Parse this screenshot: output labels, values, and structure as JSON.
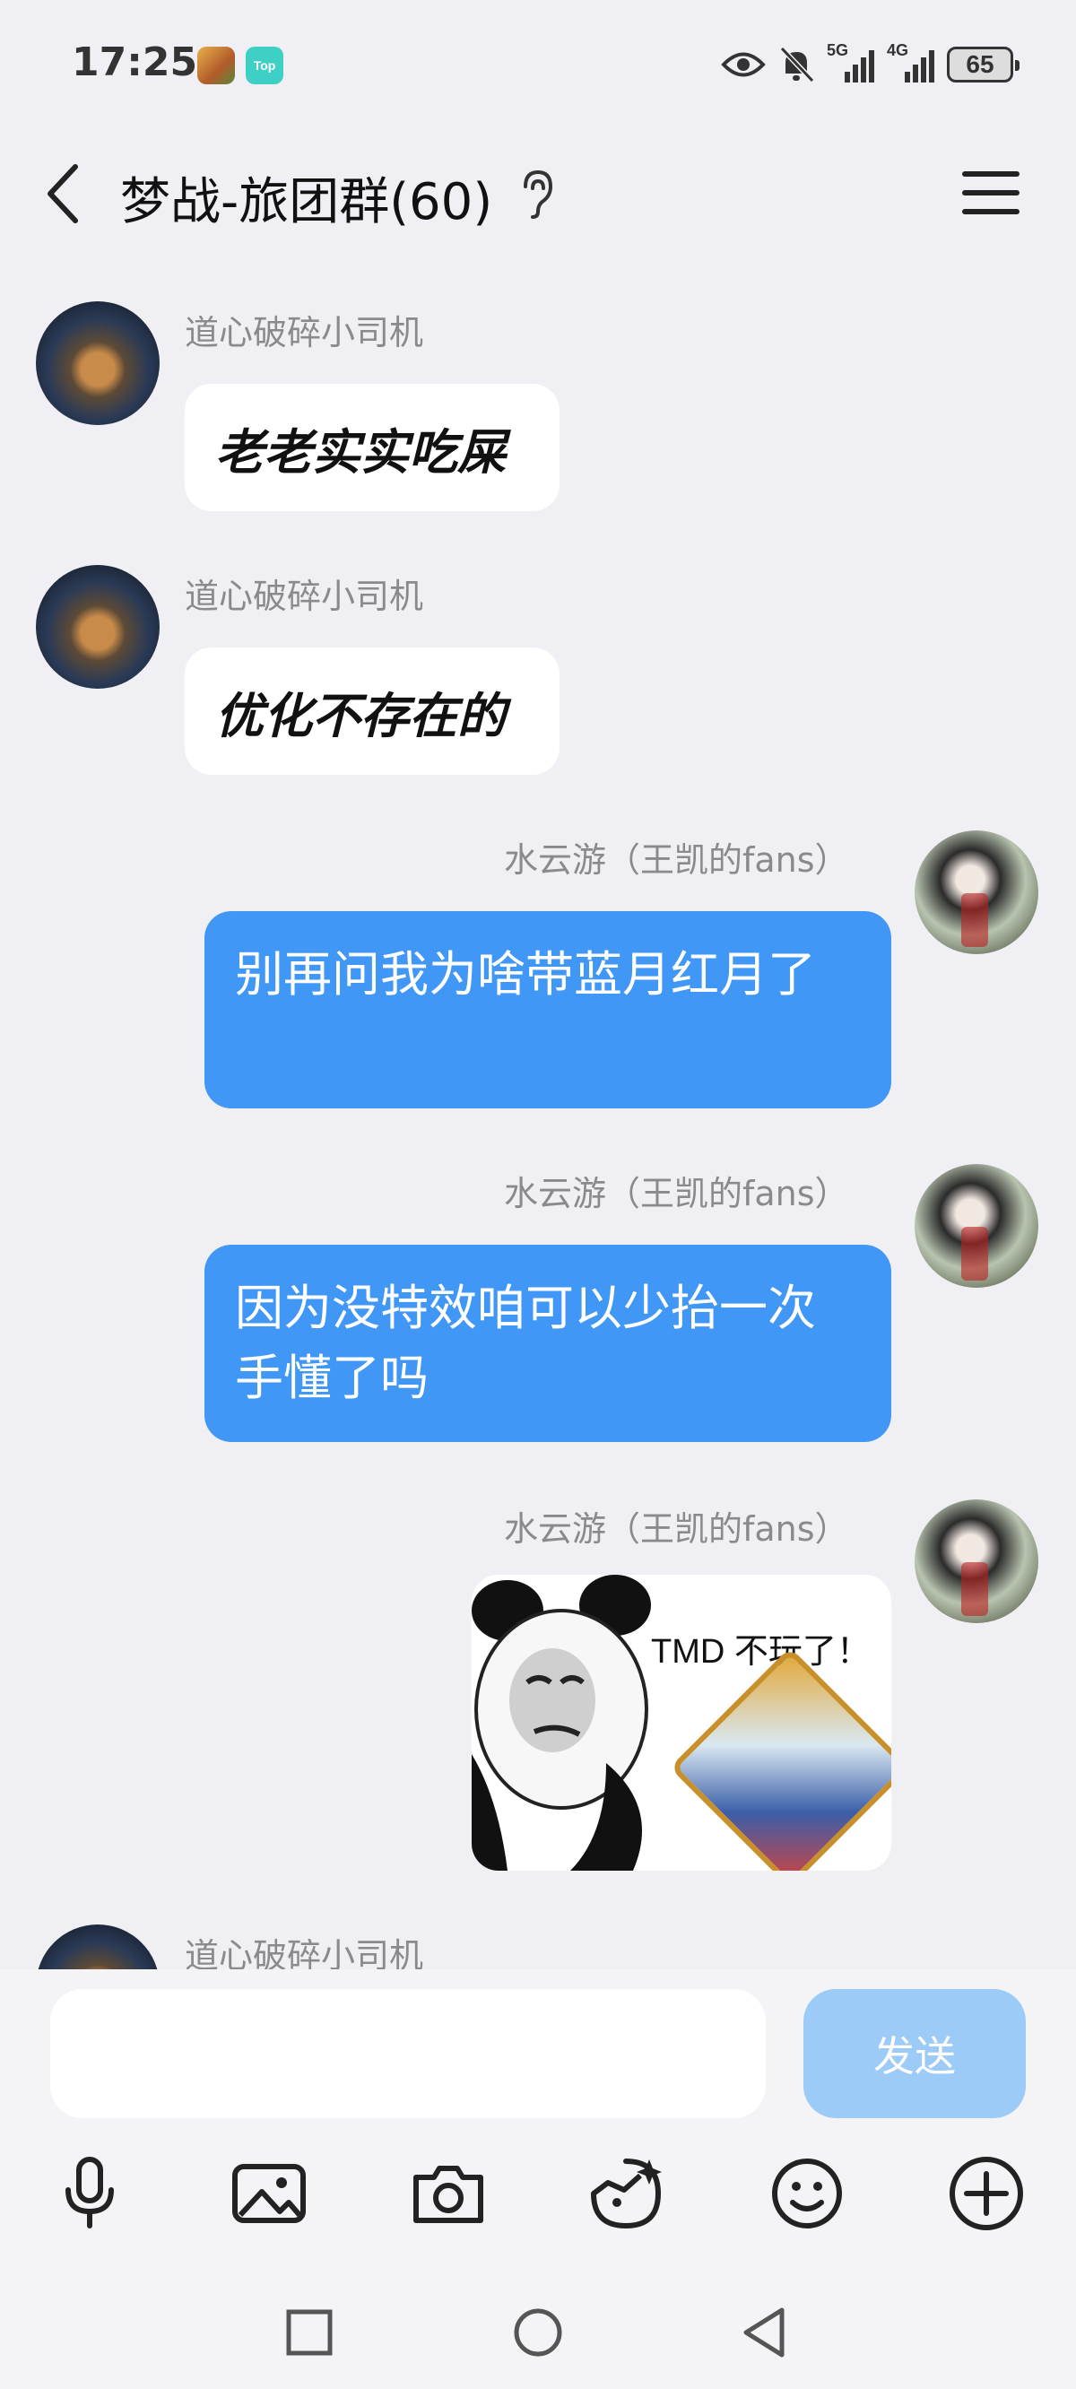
{
  "status_bar": {
    "time": "17:25",
    "top_badge": "Top",
    "signal_5g": "5G",
    "signal_4g": "4G",
    "battery": "65"
  },
  "header": {
    "title": "梦战-旅团群(60)"
  },
  "messages": [
    {
      "side": "left",
      "sender": "道心破碎小司机",
      "text": "老老实实吃屎"
    },
    {
      "side": "left",
      "sender": "道心破碎小司机",
      "text": "优化不存在的"
    },
    {
      "side": "right",
      "sender": "水云游（王凯的fans）",
      "text": "别再问我为啥带蓝月红月了"
    },
    {
      "side": "right",
      "sender": "水云游（王凯的fans）",
      "text": "因为没特效咱可以少抬一次手懂了吗"
    },
    {
      "side": "right",
      "sender": "水云游（王凯的fans）",
      "sticker_text": "TMD 不玩了！"
    },
    {
      "side": "left",
      "sender": "道心破碎小司机"
    }
  ],
  "input": {
    "send_label": "发送"
  },
  "icons": {
    "back": "chevron-left-icon",
    "ear": "ear-icon",
    "menu": "menu-icon",
    "mic": "microphone-icon",
    "image": "image-icon",
    "camera": "camera-icon",
    "sticker": "sticker-icon",
    "emoji": "emoji-icon",
    "plus": "plus-circle-icon"
  },
  "colors": {
    "bubble_right": "#4197f5",
    "send_button": "#8ec4f8",
    "background": "#f0f0f4"
  }
}
